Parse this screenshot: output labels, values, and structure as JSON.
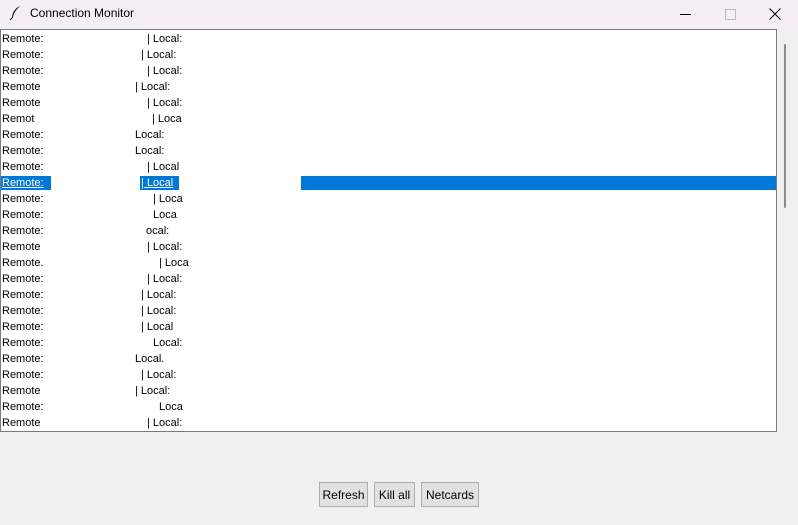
{
  "window": {
    "title": "Connection Monitor",
    "controls": {
      "minimize": "minimize",
      "maximize": "maximize",
      "close": "close"
    }
  },
  "listbox": {
    "selected_index": 9,
    "accent": "#0078d7",
    "rows": [
      {
        "remote": "Remote:",
        "local": "| Local:"
      },
      {
        "remote": "Remote:",
        "local": "| Local:"
      },
      {
        "remote": "Remote:",
        "local": "| Local:"
      },
      {
        "remote": "Remote",
        "local": "| Local:"
      },
      {
        "remote": "Remote",
        "local": "| Local:"
      },
      {
        "remote": "Remot",
        "local": "| Loca"
      },
      {
        "remote": "Remote:",
        "local": "Local:"
      },
      {
        "remote": "Remote:",
        "local": "Local:"
      },
      {
        "remote": "Remote:",
        "local": "| Local"
      },
      {
        "remote": "Remote:",
        "local": "| Local"
      },
      {
        "remote": "Remote:",
        "local": "| Loca"
      },
      {
        "remote": "Remote:",
        "local": "Loca"
      },
      {
        "remote": "Remote:",
        "local": "ocal:"
      },
      {
        "remote": "Remote",
        "local": "| Local:"
      },
      {
        "remote": "Remote.",
        "local": "| Loca"
      },
      {
        "remote": "Remote:",
        "local": "| Local:"
      },
      {
        "remote": "Remote:",
        "local": "| Local:"
      },
      {
        "remote": "Remote:",
        "local": "| Local:"
      },
      {
        "remote": "Remote:",
        "local": "| Local"
      },
      {
        "remote": "Remote:",
        "local": "Local:"
      },
      {
        "remote": "Remote:",
        "local": "Local."
      },
      {
        "remote": "Remote:",
        "local": "| Local:"
      },
      {
        "remote": "Remote",
        "local": "| Local:"
      },
      {
        "remote": "Remote:",
        "local": "Loca"
      },
      {
        "remote": "Remote",
        "local": "| Local:"
      }
    ]
  },
  "buttons": {
    "refresh": "Refresh",
    "kill_all": "Kill all",
    "netcards": "Netcards"
  }
}
